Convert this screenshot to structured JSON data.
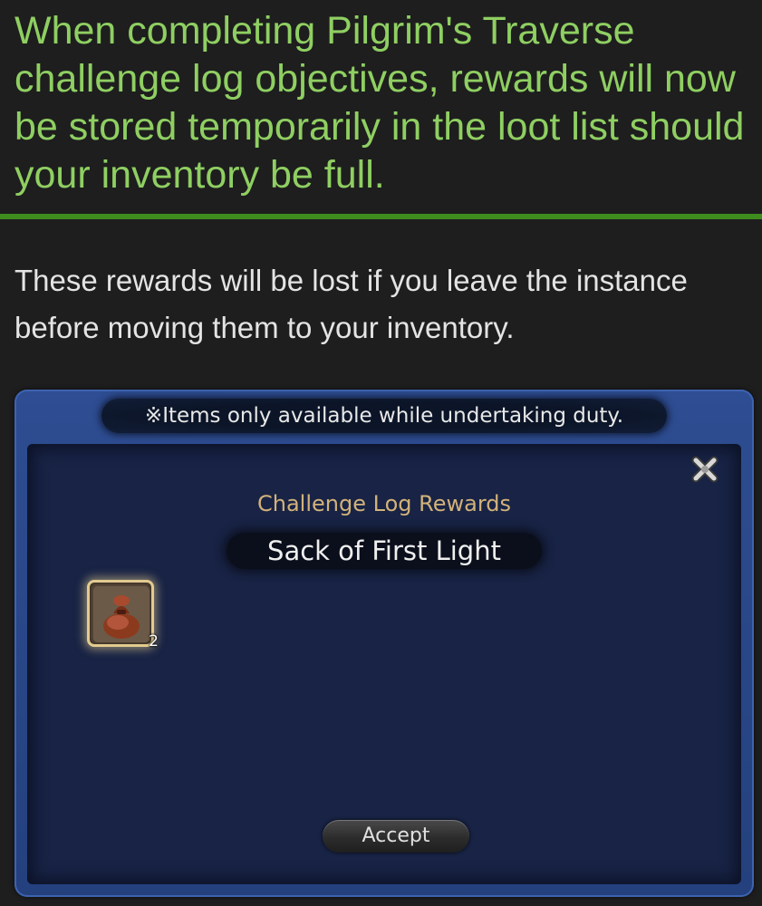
{
  "article": {
    "headline": "When completing Pilgrim's Traverse challenge log objectives, rewards will now be stored temporarily in the loot list should your inventory be full.",
    "note": "These rewards will be lost if you leave the instance before moving them to your inventory."
  },
  "game_window": {
    "duty_banner": "※Items only available while undertaking duty.",
    "close_icon": "crossed-x-icon",
    "rewards_title": "Challenge Log Rewards",
    "item_name": "Sack of First Light",
    "item": {
      "icon": "sack-icon",
      "quantity": "2"
    },
    "accept_label": "Accept"
  },
  "colors": {
    "headline": "#8fcf62",
    "rule": "#3f8c1e",
    "window_frame": "#2e4d92",
    "rewards_title": "#d2b27a",
    "slot_border": "#e2cb8f"
  }
}
